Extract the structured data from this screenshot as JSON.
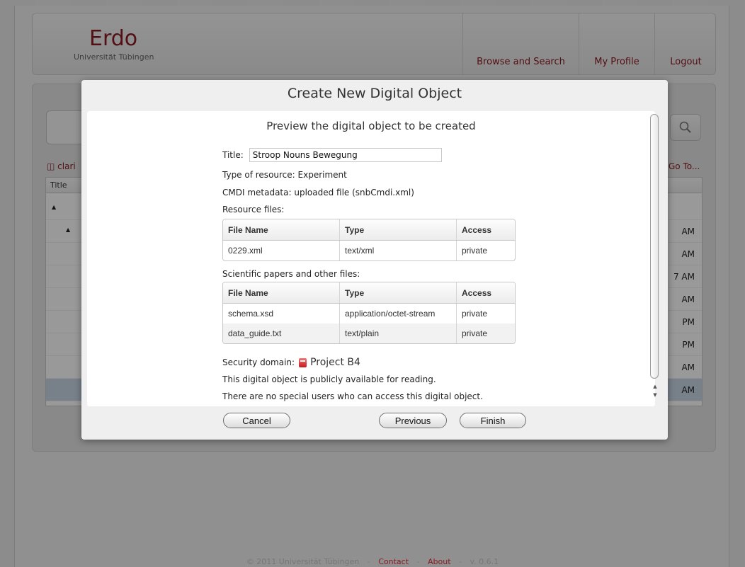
{
  "app": {
    "logo_title": "Erdo",
    "logo_subtitle": "Universität Tübingen"
  },
  "nav": {
    "browse": "Browse and Search",
    "profile": "My Profile",
    "logout": "Logout"
  },
  "background": {
    "db_label": "clari",
    "goto_label": "Go To...",
    "column_title": "Title",
    "times": [
      "AM",
      "AM",
      "7 AM",
      "AM",
      "PM",
      "PM",
      "AM",
      "AM"
    ]
  },
  "dialog": {
    "title": "Create New Digital Object",
    "heading": "Preview the digital object to be created",
    "title_label": "Title:",
    "title_value": "Stroop Nouns Bewegung",
    "type_of_resource": "Type of resource: Experiment",
    "cmdi_metadata": "CMDI metadata: uploaded file (snbCmdi.xml)",
    "resource_files_label": "Resource files:",
    "resource_table": {
      "headers": [
        "File Name",
        "Type",
        "Access"
      ],
      "rows": [
        [
          "0229.xml",
          "text/xml",
          "private"
        ]
      ]
    },
    "papers_label": "Scientific papers and other files:",
    "papers_table": {
      "headers": [
        "File Name",
        "Type",
        "Access"
      ],
      "rows": [
        [
          "schema.xsd",
          "application/octet-stream",
          "private"
        ],
        [
          "data_guide.txt",
          "text/plain",
          "private"
        ]
      ]
    },
    "security_label": "Security domain:",
    "security_project": "Project B4",
    "public_note": "This digital object is publicly available for reading.",
    "special_users_note": "There are no special users who can access this digital object.",
    "buttons": {
      "cancel": "Cancel",
      "previous": "Previous",
      "finish": "Finish"
    }
  },
  "footer": {
    "copyright": "© 2011 Universität Tübingen",
    "contact": "Contact",
    "about": "About",
    "version": "v. 0.6.1"
  },
  "colors": {
    "brand": "#8a1c22",
    "selected_row": "#c9d6e6"
  }
}
